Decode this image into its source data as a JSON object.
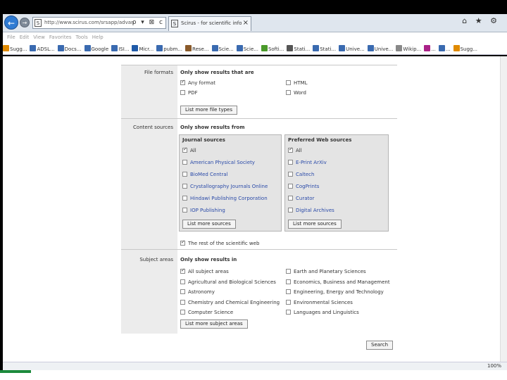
{
  "browser": {
    "url": "http://www.scirus.com/srsapp/advanced/index_",
    "address_controls": "ρ ▾ ⊠ c",
    "tab_title": "Scirus - for scientific inform...",
    "tab_close": "×",
    "window_icons": "⌂ ★ ⚙",
    "favicon": "S",
    "menu": [
      "File",
      "Edit",
      "View",
      "Favorites",
      "Tools",
      "Help"
    ],
    "favorites": [
      {
        "label": "Sugg...",
        "color": "#e08a00"
      },
      {
        "label": "ADSL...",
        "color": "#3a6ab0"
      },
      {
        "label": "Docs...",
        "color": "#3a6ab0"
      },
      {
        "label": "Google",
        "color": "#3a6ab0"
      },
      {
        "label": "ISI...",
        "color": "#3a6ab0"
      },
      {
        "label": "Micr...",
        "color": "#1f5aa8"
      },
      {
        "label": "pubm...",
        "color": "#3a6ab0"
      },
      {
        "label": "Rese...",
        "color": "#8a5a2a"
      },
      {
        "label": "Scie...",
        "color": "#3a6ab0"
      },
      {
        "label": "Scie...",
        "color": "#3a6ab0"
      },
      {
        "label": "Softi...",
        "color": "#4a9a2a"
      },
      {
        "label": "Stati...",
        "color": "#555555"
      },
      {
        "label": "Stati...",
        "color": "#3a6ab0"
      },
      {
        "label": "Unive...",
        "color": "#3a6ab0"
      },
      {
        "label": "Unive...",
        "color": "#3a6ab0"
      },
      {
        "label": "Wikip...",
        "color": "#888888"
      },
      {
        "label": "...",
        "color": "#aa2288"
      },
      {
        "label": "...",
        "color": "#3a6ab0"
      },
      {
        "label": "Sugg...",
        "color": "#e08a00"
      }
    ],
    "zoom": "100%"
  },
  "file_formats": {
    "label": "File formats",
    "title": "Only show results that are",
    "options_left": [
      {
        "label": "Any format",
        "checked": true
      },
      {
        "label": "PDF",
        "checked": false
      }
    ],
    "options_right": [
      {
        "label": "HTML",
        "checked": false
      },
      {
        "label": "Word",
        "checked": false
      }
    ],
    "list_more": "List more file types"
  },
  "content_sources": {
    "label": "Content sources",
    "title": "Only show results from",
    "journal": {
      "heading": "Journal sources",
      "items": [
        {
          "label": "All",
          "checked": true
        },
        {
          "label": "American Physical Society",
          "checked": false
        },
        {
          "label": "BioMed Central",
          "checked": false
        },
        {
          "label": "Crystallography Journals Online",
          "checked": false
        },
        {
          "label": "Hindawi Publishing Corporation",
          "checked": false
        },
        {
          "label": "IOP Publishing",
          "checked": false
        }
      ],
      "list_more": "List more sources"
    },
    "web": {
      "heading": "Preferred Web sources",
      "items": [
        {
          "label": "All",
          "checked": true
        },
        {
          "label": "E-Print ArXiv",
          "checked": false
        },
        {
          "label": "Caltech",
          "checked": false
        },
        {
          "label": "CogPrints",
          "checked": false
        },
        {
          "label": "Curator",
          "checked": false
        },
        {
          "label": "Digital Archives",
          "checked": false
        }
      ],
      "list_more": "List more sources"
    },
    "rest_of_web": "The rest of the scientific web"
  },
  "subject_areas": {
    "label": "Subject areas",
    "title": "Only show results in",
    "left": [
      {
        "label": "All subject areas",
        "checked": true
      },
      {
        "label": "Agricultural and Biological Sciences",
        "checked": false
      },
      {
        "label": "Astronomy",
        "checked": false
      },
      {
        "label": "Chemistry and Chemical Engineering",
        "checked": false
      },
      {
        "label": "Computer Science",
        "checked": false
      }
    ],
    "right": [
      {
        "label": "Earth and Planetary Sciences",
        "checked": false
      },
      {
        "label": "Economics, Business and Management",
        "checked": false
      },
      {
        "label": "Engineering, Energy and Technology",
        "checked": false
      },
      {
        "label": "Environmental Sciences",
        "checked": false
      },
      {
        "label": "Languages and Linguistics",
        "checked": false
      }
    ],
    "list_more": "List more subject areas"
  },
  "search_button": "Search"
}
